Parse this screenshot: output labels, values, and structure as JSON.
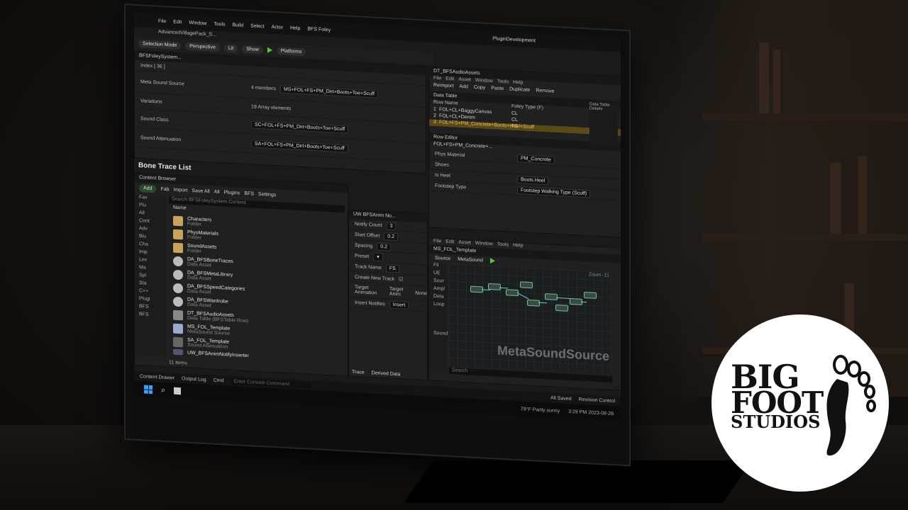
{
  "main_menu": [
    "File",
    "Edit",
    "Window",
    "Tools",
    "Build",
    "Select",
    "Actor",
    "Help",
    "BFS Foley"
  ],
  "project_tab": "AdvancedVillagePack_S...",
  "window_title": "PluginDevelopment",
  "toolbar": {
    "mode": "Selection Mode",
    "viewport": "Perspective",
    "lit": "Lit",
    "show": "Show",
    "platforms": "Platforms"
  },
  "details": {
    "tab": "BFSFoleySystem...",
    "index_label": "Index [ 36 ]",
    "rows": [
      {
        "label": "Meta Sound Source",
        "value": "4 members",
        "asset": "MS+FOL+FS+PM_Dirt+Boots+Toe+Scuff"
      },
      {
        "label": "Variations",
        "value": "19 Array elements",
        "asset": ""
      },
      {
        "label": "Sound Class",
        "value": "",
        "asset": "SC+FOL+FS+PM_Dirt+Boots+Toe+Scuff"
      },
      {
        "label": "Sound Attenuation",
        "value": "",
        "asset": "SA+FOL+FS+PM_Dirt+Boots+Toe+Scuff"
      }
    ]
  },
  "bone_trace_title": "Bone Trace List",
  "content_browser": {
    "tab": "Content Browser",
    "add": "Add",
    "fab": "Fab",
    "import": "Import",
    "save_all": "Save All",
    "settings": "Settings",
    "path": [
      "All",
      "Plugins",
      "BFS"
    ],
    "search_placeholder": "Search BFSFoleySystem Content",
    "name_header": "Name",
    "tree": [
      "Fav",
      "Plu",
      "All",
      "Cont",
      "Adv",
      "Blu",
      "Cha",
      "Imp",
      "Lev",
      "Ma",
      "Spl",
      "Sta",
      "C++",
      "Plugi",
      "BFS",
      "BFS"
    ],
    "items": [
      {
        "name": "Characters",
        "type": "Folder",
        "kind": "folder"
      },
      {
        "name": "PhysMaterials",
        "type": "Folder",
        "kind": "folder"
      },
      {
        "name": "SoundAssets",
        "type": "Folder",
        "kind": "folder"
      },
      {
        "name": "DA_BFSBoneTraces",
        "type": "Data Asset",
        "kind": "data"
      },
      {
        "name": "DA_BFSMetaLibrary",
        "type": "Data Asset",
        "kind": "data"
      },
      {
        "name": "DA_BFSSpeedCategories",
        "type": "Data Asset",
        "kind": "data"
      },
      {
        "name": "DA_BFSWardrobe",
        "type": "Data Asset",
        "kind": "data"
      },
      {
        "name": "DT_BFSAudioAssets",
        "type": "Data Table (BFSTable Row)",
        "kind": "table"
      },
      {
        "name": "MS_FOL_Template",
        "type": "MetaSound Source",
        "kind": "ms"
      },
      {
        "name": "SA_FOL_Template",
        "type": "Sound Attenuation",
        "kind": "sa"
      },
      {
        "name": "UW_BFSAnimNotifyInserter",
        "type": "",
        "kind": "uw"
      }
    ],
    "item_count": "11 items"
  },
  "notify_panel": {
    "tab": "UW BFSAnim No...",
    "fields": [
      {
        "label": "Notify Count",
        "value": "3"
      },
      {
        "label": "Start Offset",
        "value": "0.2"
      },
      {
        "label": "Spacing",
        "value": "0.2"
      },
      {
        "label": "Preset",
        "value": ""
      },
      {
        "label": "Track Name",
        "value": "FS"
      },
      {
        "label": "Create New Track",
        "value": ""
      }
    ],
    "target_label": "Target Animation",
    "target_value": "Target Anim",
    "none": "None",
    "insert_label": "Insert Notifies",
    "insert_btn": "Insert",
    "trace": "Trace",
    "derived": "Derived Data"
  },
  "datatable": {
    "tab": "DT_BFSAudioAssets",
    "menu": [
      "File",
      "Edit",
      "Asset",
      "Window",
      "Tools",
      "Help"
    ],
    "buttons": [
      "Reimport",
      "Add",
      "Copy",
      "Paste",
      "Duplicate",
      "Remove"
    ],
    "table_tab": "Data Table",
    "columns": [
      "Row Name",
      "Foley Type (F)"
    ],
    "rows": [
      {
        "n": "1",
        "name": "FOL+CL+BaggyCanvas",
        "type": "CL"
      },
      {
        "n": "2",
        "name": "FOL+CL+Denim",
        "type": "CL"
      },
      {
        "n": "3",
        "name": "FOL+FS+PM_Concrete+Boots+Heel+Scuff",
        "type": "FS"
      }
    ],
    "row_editor": "Row Editor",
    "row_editor_name": "FOL+FS+PM_Concrete+...",
    "props": [
      {
        "label": "Phys Material",
        "value": "PM_Concrete"
      },
      {
        "label": "Shoes",
        "value": ""
      },
      {
        "label": "Is Heel",
        "value": "Boots Heel"
      },
      {
        "label": "Footstep Type",
        "value": "Footstep Walking Type (Scuff)"
      }
    ],
    "defaults": "Data Table Details"
  },
  "metasound": {
    "tab": "MS_FOL_Template",
    "menu": [
      "File",
      "Edit",
      "Asset",
      "Window",
      "Tools",
      "Help"
    ],
    "buttons": [
      "Source",
      "MetaSound"
    ],
    "zoom": "Zoom -11",
    "watermark": "MetaSoundSource",
    "search_placeholder": "Search",
    "tree": [
      "Fil",
      "UE",
      "Sour",
      "Ampl",
      "Dela",
      "Loop",
      "Sound"
    ]
  },
  "bottom": {
    "content_drawer": "Content Drawer",
    "output_log": "Output Log",
    "cmd": "Cmd",
    "console_placeholder": "Enter Console Command",
    "all_saved": "All Saved",
    "revision": "Revision Control"
  },
  "clock": {
    "temp": "79°F",
    "weather": "Partly sunny",
    "time": "3:29 PM",
    "date": "2023-08-28"
  },
  "logo": {
    "line1": "BIG",
    "line2": "FOOT",
    "line3": "STUDIOS"
  }
}
